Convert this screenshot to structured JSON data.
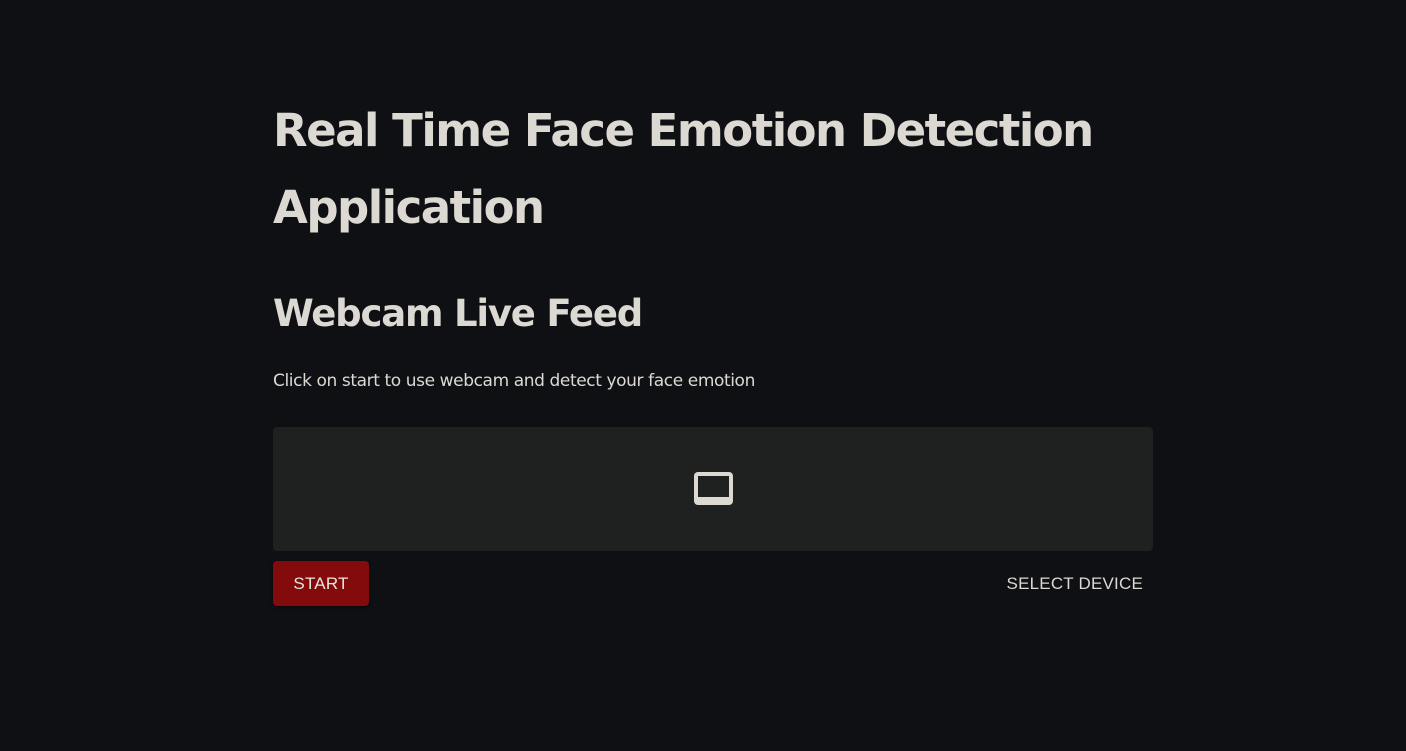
{
  "page": {
    "title": "Real Time Face Emotion Detection Application",
    "subtitle": "Webcam Live Feed",
    "description": "Click on start to use webcam and detect your face emotion"
  },
  "webcam": {
    "placeholder_icon": "video-display-icon",
    "start_label": "START",
    "select_device_label": "SELECT DEVICE"
  },
  "colors": {
    "background": "#0e1013",
    "text": "#dcd9d3",
    "video_box": "#1f2020",
    "start_button": "#830b0b"
  }
}
